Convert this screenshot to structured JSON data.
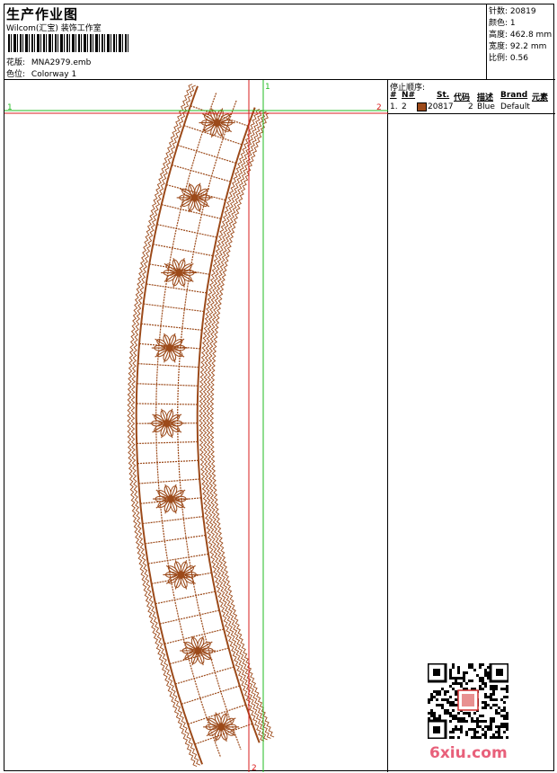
{
  "header": {
    "title": "生产作业图",
    "company": "Wilcom(汇宝) 装饰工作室",
    "design_label": "花版:",
    "design_value": "MNA2979.emb",
    "colorway_label": "色位:",
    "colorway_value": "Colorway 1"
  },
  "stats": {
    "stitches_label": "针数:",
    "stitches_value": "20819",
    "colors_label": "颜色:",
    "colors_value": "1",
    "height_label": "高度:",
    "height_value": "462.8 mm",
    "width_label": "宽度:",
    "width_value": "92.2 mm",
    "scale_label": "比例:",
    "scale_value": "0.56"
  },
  "stop_sequence": {
    "title": "停止顺序:",
    "columns": [
      "#",
      "N#",
      "St.",
      "代码",
      "描述",
      "Brand",
      "元素"
    ],
    "rows": [
      {
        "idx": "1.",
        "n": "2",
        "st": "20817",
        "code": "2",
        "desc": "Blue",
        "brand": "Default",
        "color": "#9c4a1a"
      }
    ]
  },
  "guides": {
    "h_left": "1",
    "h_right": "2",
    "v_top": "1",
    "v_bottom": "2"
  },
  "watermark": {
    "text": "6xiu.com",
    "color": "#e8607a"
  },
  "design_color": "#9c4a1a"
}
